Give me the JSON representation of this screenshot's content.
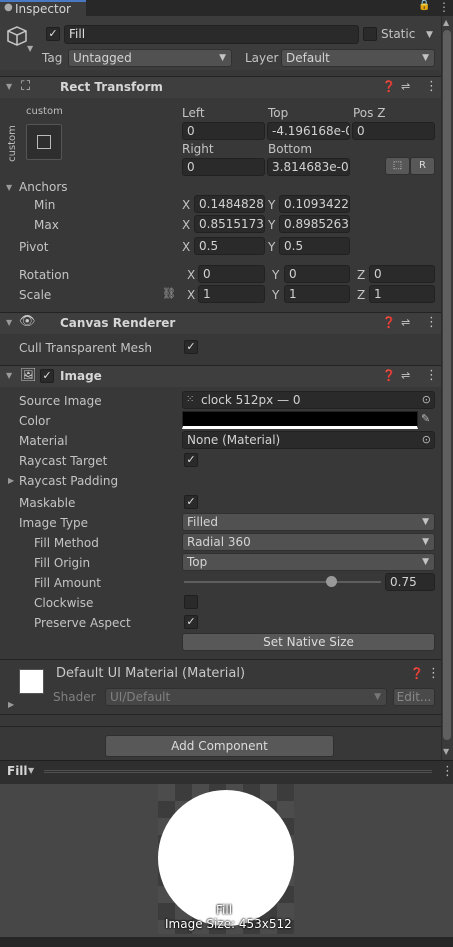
{
  "tab": {
    "title": "Inspector"
  },
  "header": {
    "name": "Fill",
    "static_label": "Static",
    "tag_label": "Tag",
    "tag_value": "Untagged",
    "layer_label": "Layer",
    "layer_value": "Default"
  },
  "rect_transform": {
    "title": "Rect Transform",
    "anchor_preset_top": "custom",
    "anchor_preset_side": "custom",
    "left_label": "Left",
    "left_value": "0",
    "top_label": "Top",
    "top_value": "-4.196168e-0",
    "posz_label": "Pos Z",
    "posz_value": "0",
    "right_label": "Right",
    "right_value": "0",
    "bottom_label": "Bottom",
    "bottom_value": "3.814683e-0(",
    "r_button": "R",
    "anchors_label": "Anchors",
    "min_label": "Min",
    "min_x": "0.1484828",
    "min_y": "0.1093422",
    "max_label": "Max",
    "max_x": "0.8515173",
    "max_y": "0.8985263",
    "pivot_label": "Pivot",
    "pivot_x": "0.5",
    "pivot_y": "0.5",
    "rotation_label": "Rotation",
    "rot_x": "0",
    "rot_y": "0",
    "rot_z": "0",
    "scale_label": "Scale",
    "scale_x": "1",
    "scale_y": "1",
    "scale_z": "1",
    "x": "X",
    "y": "Y",
    "z": "Z"
  },
  "canvas_renderer": {
    "title": "Canvas Renderer",
    "cull_label": "Cull Transparent Mesh"
  },
  "image": {
    "title": "Image",
    "source_image_label": "Source Image",
    "source_image_value": "clock 512px — 0",
    "color_label": "Color",
    "color_value": "#000000",
    "material_label": "Material",
    "material_value": "None (Material)",
    "raycast_target_label": "Raycast Target",
    "raycast_padding_label": "Raycast Padding",
    "maskable_label": "Maskable",
    "image_type_label": "Image Type",
    "image_type_value": "Filled",
    "fill_method_label": "Fill Method",
    "fill_method_value": "Radial 360",
    "fill_origin_label": "Fill Origin",
    "fill_origin_value": "Top",
    "fill_amount_label": "Fill Amount",
    "fill_amount_value": "0.75",
    "clockwise_label": "Clockwise",
    "preserve_aspect_label": "Preserve Aspect",
    "set_native_size": "Set Native Size"
  },
  "material": {
    "title": "Default UI Material (Material)",
    "shader_label": "Shader",
    "shader_value": "UI/Default",
    "edit_button": "Edit..."
  },
  "add_component": "Add Component",
  "preview": {
    "dropdown_label": "Fill",
    "name": "Fill",
    "size_text": "Image Size: 453x512"
  },
  "colors": {
    "accent": "#4a78c2",
    "background": "#383838"
  }
}
